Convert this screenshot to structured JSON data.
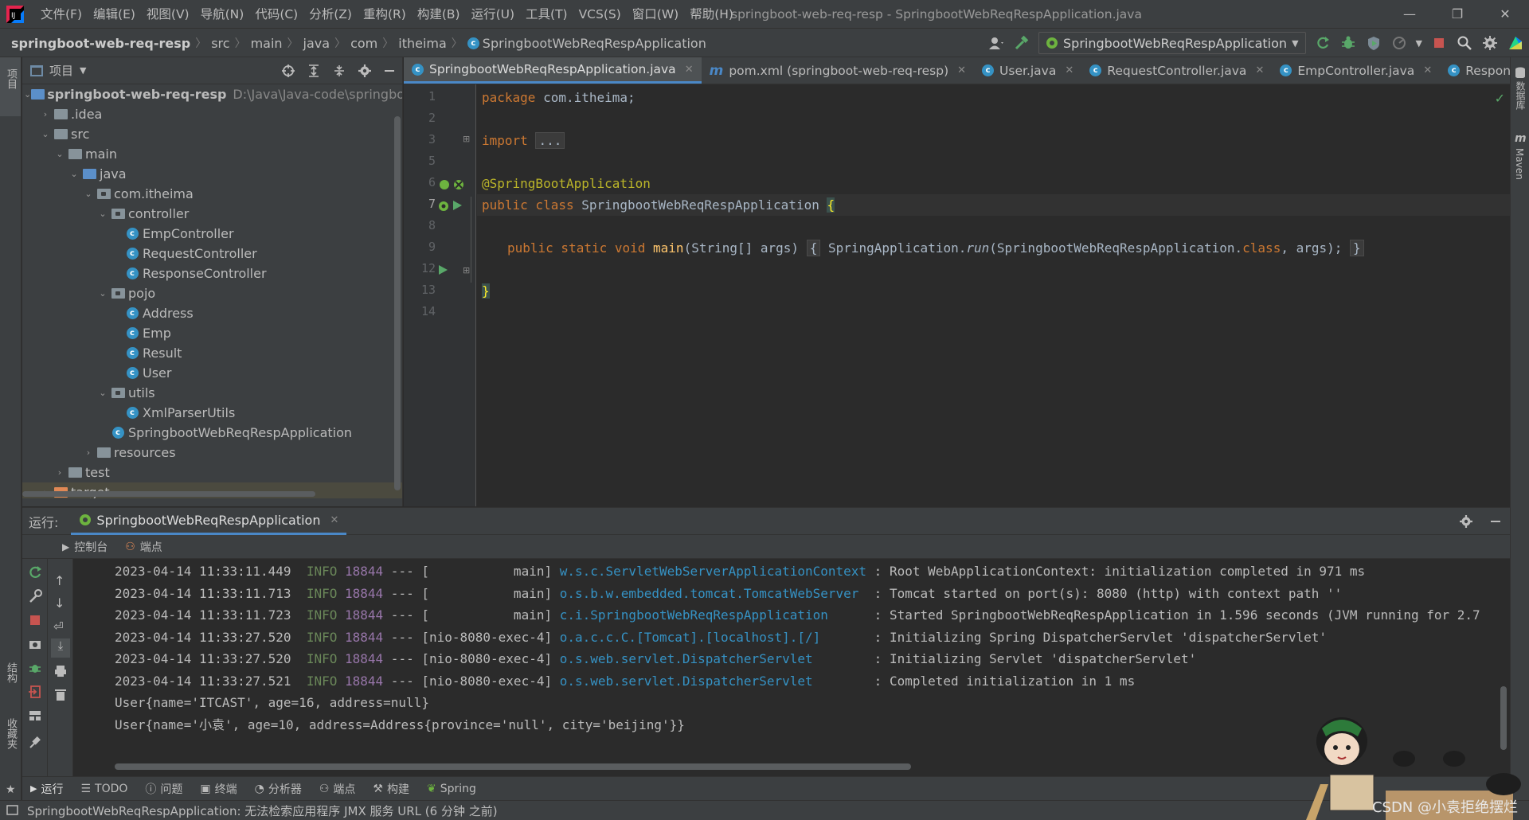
{
  "menubar": {
    "items": [
      "文件(F)",
      "编辑(E)",
      "视图(V)",
      "导航(N)",
      "代码(C)",
      "分析(Z)",
      "重构(R)",
      "构建(B)",
      "运行(U)",
      "工具(T)",
      "VCS(S)",
      "窗口(W)",
      "帮助(H)"
    ],
    "window_title": "springboot-web-req-resp - SpringbootWebReqRespApplication.java"
  },
  "breadcrumb": [
    "springboot-web-req-resp",
    "src",
    "main",
    "java",
    "com",
    "itheima",
    "SpringbootWebReqRespApplication"
  ],
  "run_config": "SpringbootWebReqRespApplication",
  "left_strip": {
    "project": "项目",
    "structure": "结构",
    "favorites": "收藏夹"
  },
  "right_strip": {
    "database": "数据库",
    "maven": "Maven"
  },
  "project": {
    "title": "项目",
    "root_name": "springboot-web-req-resp",
    "root_path": "D:\\Java\\Java-code\\springboot-",
    "nodes": [
      {
        "label": ".idea"
      },
      {
        "label": "src"
      },
      {
        "label": "main"
      },
      {
        "label": "java"
      },
      {
        "label": "com.itheima"
      },
      {
        "label": "controller"
      },
      {
        "label": "EmpController"
      },
      {
        "label": "RequestController"
      },
      {
        "label": "ResponseController"
      },
      {
        "label": "pojo"
      },
      {
        "label": "Address"
      },
      {
        "label": "Emp"
      },
      {
        "label": "Result"
      },
      {
        "label": "User"
      },
      {
        "label": "utils"
      },
      {
        "label": "XmlParserUtils"
      },
      {
        "label": "SpringbootWebReqRespApplication"
      },
      {
        "label": "resources"
      },
      {
        "label": "test"
      },
      {
        "label": "target"
      }
    ]
  },
  "editor": {
    "tabs": [
      {
        "label": "SpringbootWebReqRespApplication.java"
      },
      {
        "label": "pom.xml (springboot-web-req-resp)"
      },
      {
        "label": "User.java"
      },
      {
        "label": "RequestController.java"
      },
      {
        "label": "EmpController.java"
      },
      {
        "label": "Response"
      }
    ],
    "line_numbers": [
      "1",
      "2",
      "3",
      "5",
      "6",
      "7",
      "8",
      "9",
      "12",
      "13",
      "14"
    ],
    "code": {
      "l1_kw": "package",
      "l1_rest": " com.itheima;",
      "l3_kw": "import",
      "l3_fold": "...",
      "l6": "@SpringBootApplication",
      "l7_kw": "public class",
      "l7_name": " SpringbootWebReqRespApplication ",
      "l7_brace": "{",
      "l9_kw": "public static void",
      "l9_main": " main",
      "l9_sig": "(String[] args) ",
      "l9_open": "{",
      "l9_body_a": " SpringApplication.",
      "l9_run": "run",
      "l9_body_b": "(SpringbootWebReqRespApplication.",
      "l9_class": "class",
      "l9_body_c": ", args); ",
      "l9_close": "}",
      "l13": "}"
    }
  },
  "run": {
    "label": "运行:",
    "tab": "SpringbootWebReqRespApplication",
    "subtabs": [
      "控制台",
      "端点"
    ],
    "console": [
      {
        "ts": "2023-04-14 11:33:11.449",
        "lvl": "INFO",
        "pid": "18844",
        "th": " --- [           main] ",
        "logger": "w.s.c.ServletWebServerApplicationContext",
        "msg": " : Root WebApplicationContext: initialization completed in 971 ms"
      },
      {
        "ts": "2023-04-14 11:33:11.713",
        "lvl": "INFO",
        "pid": "18844",
        "th": " --- [           main] ",
        "logger": "o.s.b.w.embedded.tomcat.TomcatWebServer ",
        "msg": " : Tomcat started on port(s): 8080 (http) with context path ''"
      },
      {
        "ts": "2023-04-14 11:33:11.723",
        "lvl": "INFO",
        "pid": "18844",
        "th": " --- [           main] ",
        "logger": "c.i.SpringbootWebReqRespApplication     ",
        "msg": " : Started SpringbootWebReqRespApplication in 1.596 seconds (JVM running for 2.7"
      },
      {
        "ts": "2023-04-14 11:33:27.520",
        "lvl": "INFO",
        "pid": "18844",
        "th": " --- [nio-8080-exec-4] ",
        "logger": "o.a.c.c.C.[Tomcat].[localhost].[/]      ",
        "msg": " : Initializing Spring DispatcherServlet 'dispatcherServlet'"
      },
      {
        "ts": "2023-04-14 11:33:27.520",
        "lvl": "INFO",
        "pid": "18844",
        "th": " --- [nio-8080-exec-4] ",
        "logger": "o.s.web.servlet.DispatcherServlet       ",
        "msg": " : Initializing Servlet 'dispatcherServlet'"
      },
      {
        "ts": "2023-04-14 11:33:27.521",
        "lvl": "INFO",
        "pid": "18844",
        "th": " --- [nio-8080-exec-4] ",
        "logger": "o.s.web.servlet.DispatcherServlet       ",
        "msg": " : Completed initialization in 1 ms"
      }
    ],
    "output": [
      "User{name='ITCAST', age=16, address=null}",
      "User{name='小袁', age=10, address=Address{province='null', city='beijing'}}"
    ]
  },
  "bottombar": [
    "运行",
    "TODO",
    "问题",
    "终端",
    "分析器",
    "端点",
    "构建",
    "Spring"
  ],
  "status": "SpringbootWebReqRespApplication: 无法检索应用程序 JMX 服务 URL (6 分钟 之前)",
  "watermark": "CSDN @小袁拒绝摆烂",
  "colors": {
    "accent": "#4a88c7",
    "class_icon": "#3592c4",
    "keyword": "#cc7832",
    "annotation": "#bbb529",
    "info": "#6a8759"
  }
}
